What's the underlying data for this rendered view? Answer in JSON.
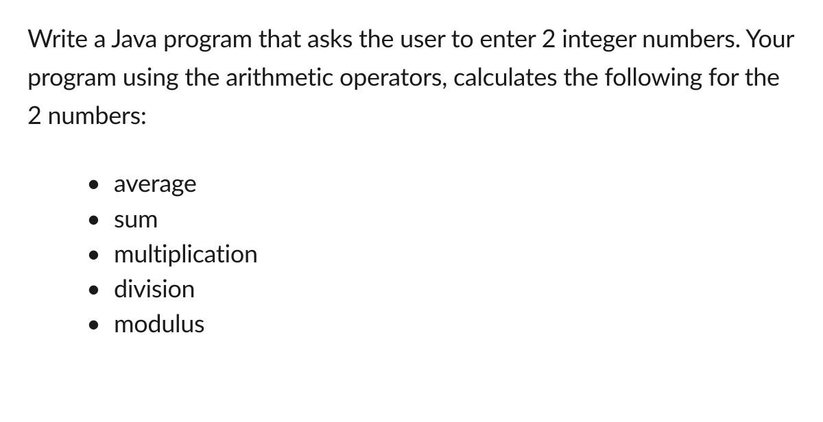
{
  "paragraph": "Write a Java program that asks the user to enter 2 integer numbers. Your program using the arithmetic operators, calculates the following for the 2 numbers:",
  "bullets": [
    "average",
    "sum",
    "multiplication",
    "division",
    "modulus"
  ]
}
